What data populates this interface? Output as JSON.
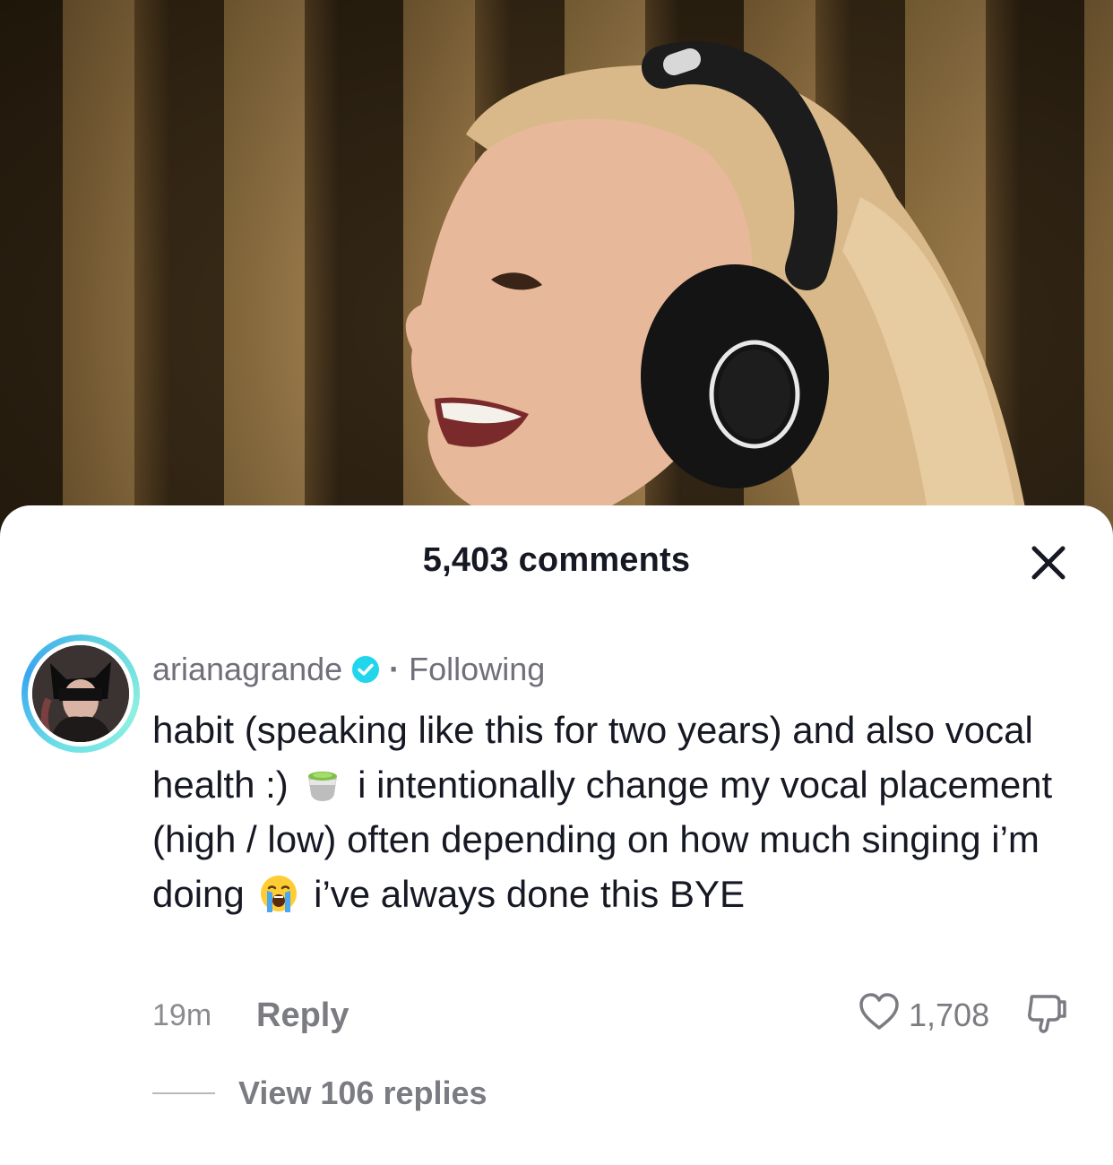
{
  "sheet": {
    "title": "5,403 comments",
    "close_icon": "close-icon"
  },
  "comment": {
    "username": "arianagrande",
    "verified_icon": "verified-badge-icon",
    "separator": "·",
    "follow_status": "Following",
    "text_parts": {
      "part1": "habit (speaking like this for two years) and also vocal health :)",
      "emoji1": "teacup-icon",
      "part2": "i intentionally change my vocal placement (high / low) often depending on how much singing i’m doing",
      "emoji2": "loudly-crying-face-icon",
      "part3": "i’ve always done this BYE"
    },
    "time": "19m",
    "reply_label": "Reply",
    "like_count": "1,708",
    "view_replies": "View 106 replies"
  },
  "colors": {
    "text_primary": "#161823",
    "text_secondary": "#6f7079",
    "verified": "#20d5ec",
    "avatar_ring": "#5fd3e0"
  }
}
